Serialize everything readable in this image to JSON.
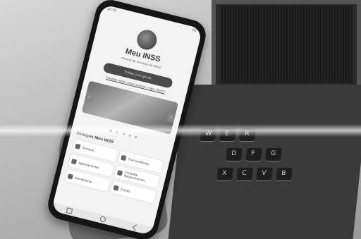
{
  "phone_app": {
    "app_title": "Meu INSS",
    "subtitle": "Central de Serviços do INSS",
    "login_button": "Entrar com gov.br",
    "help_link": "Dúvidas sobre como acessar o Meu INSS?",
    "banner_prev": "‹",
    "banner_next": "›",
    "services_heading": "Serviços Meu INSS",
    "services": [
      {
        "label": "Serviços",
        "icon": "document-icon"
      },
      {
        "label": "Tirar benefícios",
        "icon": "wallet-icon"
      },
      {
        "label": "Agendamentos",
        "icon": "calendar-icon"
      },
      {
        "label": "Consultar Requerimentos",
        "icon": "search-icon"
      },
      {
        "label": "Atendimento",
        "icon": "person-icon"
      },
      {
        "label": "Extrato",
        "icon": "receipt-icon"
      }
    ],
    "status_left": "10:15",
    "status_right": "4G"
  },
  "keyboard": {
    "keys": [
      "W",
      "E",
      "R",
      "X",
      "C",
      "V",
      "D",
      "F",
      "G",
      "B"
    ]
  },
  "colors": {
    "screen_bg": "#f3f3f3",
    "button_bg": "#4a4a4a",
    "phone_frame": "#151515"
  }
}
